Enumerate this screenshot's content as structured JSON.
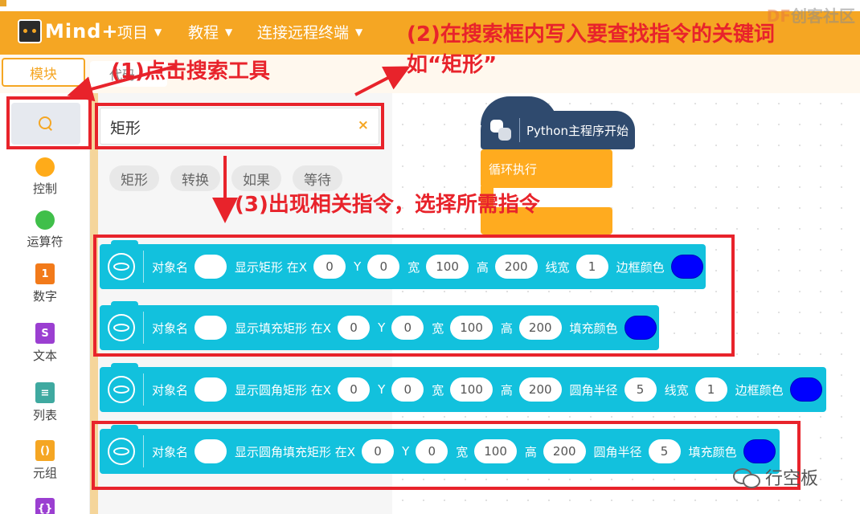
{
  "app": {
    "logo_text": "Mind+",
    "watermark_top_df": "DF",
    "watermark_top_rest": "创客社区"
  },
  "menu": [
    {
      "label": "项目"
    },
    {
      "label": "教程"
    },
    {
      "label": "连接远程终端"
    }
  ],
  "tabs": {
    "module": "模块",
    "code": "代码"
  },
  "sidebar": {
    "categories": [
      {
        "label": "控制",
        "color": "#ffab19"
      },
      {
        "label": "运算符",
        "color": "#40bf4a"
      },
      {
        "label": "数字",
        "color": "#f27a1a",
        "glyph": "1"
      },
      {
        "label": "文本",
        "color": "#9b3fd1",
        "glyph": "S"
      },
      {
        "label": "列表",
        "color": "#3fa9a0"
      },
      {
        "label": "元组",
        "color": "#f5a623"
      }
    ]
  },
  "search": {
    "value": "矩形",
    "clear": "×"
  },
  "chips": [
    "矩形",
    "转换",
    "如果",
    "等待"
  ],
  "canvas": {
    "python_start": "Python主程序开始",
    "loop": "循环执行"
  },
  "blocks": [
    {
      "segments": [
        {
          "t": "text",
          "v": "对象名"
        },
        {
          "t": "oval",
          "v": ""
        },
        {
          "t": "text",
          "v": "显示矩形 在X"
        },
        {
          "t": "oval",
          "v": "0"
        },
        {
          "t": "text",
          "v": "Y"
        },
        {
          "t": "oval",
          "v": "0"
        },
        {
          "t": "text",
          "v": "宽"
        },
        {
          "t": "oval",
          "v": "100"
        },
        {
          "t": "text",
          "v": "高"
        },
        {
          "t": "oval",
          "v": "200"
        },
        {
          "t": "text",
          "v": "线宽"
        },
        {
          "t": "oval",
          "v": "1"
        },
        {
          "t": "text",
          "v": "边框颜色"
        },
        {
          "t": "color",
          "v": "#0000ff"
        }
      ]
    },
    {
      "segments": [
        {
          "t": "text",
          "v": "对象名"
        },
        {
          "t": "oval",
          "v": ""
        },
        {
          "t": "text",
          "v": "显示填充矩形 在X"
        },
        {
          "t": "oval",
          "v": "0"
        },
        {
          "t": "text",
          "v": "Y"
        },
        {
          "t": "oval",
          "v": "0"
        },
        {
          "t": "text",
          "v": "宽"
        },
        {
          "t": "oval",
          "v": "100"
        },
        {
          "t": "text",
          "v": "高"
        },
        {
          "t": "oval",
          "v": "200"
        },
        {
          "t": "text",
          "v": "填充颜色"
        },
        {
          "t": "color",
          "v": "#0000ff"
        }
      ]
    },
    {
      "segments": [
        {
          "t": "text",
          "v": "对象名"
        },
        {
          "t": "oval",
          "v": ""
        },
        {
          "t": "text",
          "v": "显示圆角矩形 在X"
        },
        {
          "t": "oval",
          "v": "0"
        },
        {
          "t": "text",
          "v": "Y"
        },
        {
          "t": "oval",
          "v": "0"
        },
        {
          "t": "text",
          "v": "宽"
        },
        {
          "t": "oval",
          "v": "100"
        },
        {
          "t": "text",
          "v": "高"
        },
        {
          "t": "oval",
          "v": "200"
        },
        {
          "t": "text",
          "v": "圆角半径"
        },
        {
          "t": "oval",
          "v": "5"
        },
        {
          "t": "text",
          "v": "线宽"
        },
        {
          "t": "oval",
          "v": "1"
        },
        {
          "t": "text",
          "v": "边框颜色"
        },
        {
          "t": "color",
          "v": "#0000ff"
        }
      ]
    },
    {
      "segments": [
        {
          "t": "text",
          "v": "对象名"
        },
        {
          "t": "oval",
          "v": ""
        },
        {
          "t": "text",
          "v": "显示圆角填充矩形 在X"
        },
        {
          "t": "oval",
          "v": "0"
        },
        {
          "t": "text",
          "v": "Y"
        },
        {
          "t": "oval",
          "v": "0"
        },
        {
          "t": "text",
          "v": "宽"
        },
        {
          "t": "oval",
          "v": "100"
        },
        {
          "t": "text",
          "v": "高"
        },
        {
          "t": "oval",
          "v": "200"
        },
        {
          "t": "text",
          "v": "圆角半径"
        },
        {
          "t": "oval",
          "v": "5"
        },
        {
          "t": "text",
          "v": "填充颜色"
        },
        {
          "t": "color",
          "v": "#0000ff"
        }
      ]
    }
  ],
  "annotations": {
    "step1": "(1)点击搜索工具",
    "step2_line1": "(2)在搜索框内写入要查找指令的关键词",
    "step2_line2": "如“矩形”",
    "step3": "(3)出现相关指令，选择所需指令",
    "color": "#e8232b"
  },
  "watermark_bottom": "行空板"
}
